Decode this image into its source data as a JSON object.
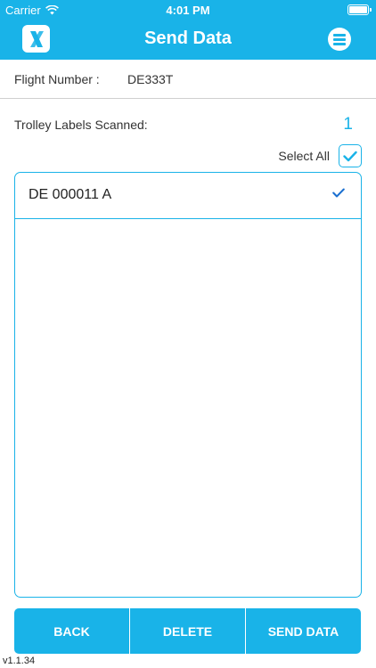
{
  "status_bar": {
    "carrier": "Carrier",
    "time": "4:01 PM"
  },
  "header": {
    "title": "Send Data",
    "logo_icon": "x-logo-icon",
    "menu_icon": "menu-icon"
  },
  "flight": {
    "label": "Flight Number :",
    "value": "DE333T"
  },
  "trolley": {
    "label": "Trolley Labels Scanned:",
    "count": "1"
  },
  "select_all": {
    "label": "Select All",
    "checked": true
  },
  "labels": [
    {
      "text": "DE 000011 A",
      "checked": true
    }
  ],
  "buttons": {
    "back": "BACK",
    "delete": "DELETE",
    "send": "SEND DATA"
  },
  "version": "v1.1.34",
  "colors": {
    "accent": "#19b3e8"
  }
}
